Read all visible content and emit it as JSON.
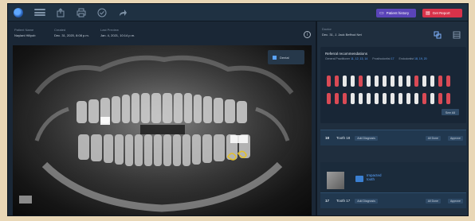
{
  "topbar": {
    "icons": [
      "logo-icon",
      "menu-icon",
      "share-icon",
      "print-icon",
      "check-icon",
      "forward-icon"
    ],
    "patient_history_label": "Patient history",
    "get_report_label": "Get Report"
  },
  "patient": {
    "name_label": "Patient Name",
    "name_value": "Naylani Hillyob",
    "created_label": "Created",
    "created_value": "Dec. 31, 2020, 8:08 p.m.",
    "last_preview_label": "Last Preview",
    "last_preview_value": "Jan. 4, 2021, 10:14 p.m."
  },
  "xray": {
    "popup_label": "Dental"
  },
  "right_panel": {
    "doctor_label": "Doctor",
    "doctor_value": "Dec. 31, J. Jack Beffrod Net",
    "recommendations_title": "Referral recommendations",
    "legend": {
      "general_label": "General Practitioner",
      "general_value": "11, 12, 13, 14",
      "prosthodontist_label": "Prosthodontist",
      "prosthodontist_value": "17",
      "endodontist_label": "Endodontist",
      "endodontist_value": "18, 19, 20"
    },
    "see_all_label": "See All",
    "tooth_rows": [
      {
        "number": "18",
        "name": "Tooth 18",
        "chip": "Add Diagnosis",
        "buttons": [
          "All Done",
          "Approve"
        ]
      },
      {
        "number": "17",
        "name": "Tooth 17",
        "chip": "Add Diagnosis",
        "buttons": [
          "All Done",
          "Approve"
        ]
      }
    ],
    "finding": {
      "line1": "Impacted",
      "line2": "tooth"
    }
  },
  "colors": {
    "accent_blue": "#5aa3ff",
    "history_purple": "#5a44b8",
    "report_red": "#d8324a",
    "panel_bg": "#1f2e3e"
  }
}
